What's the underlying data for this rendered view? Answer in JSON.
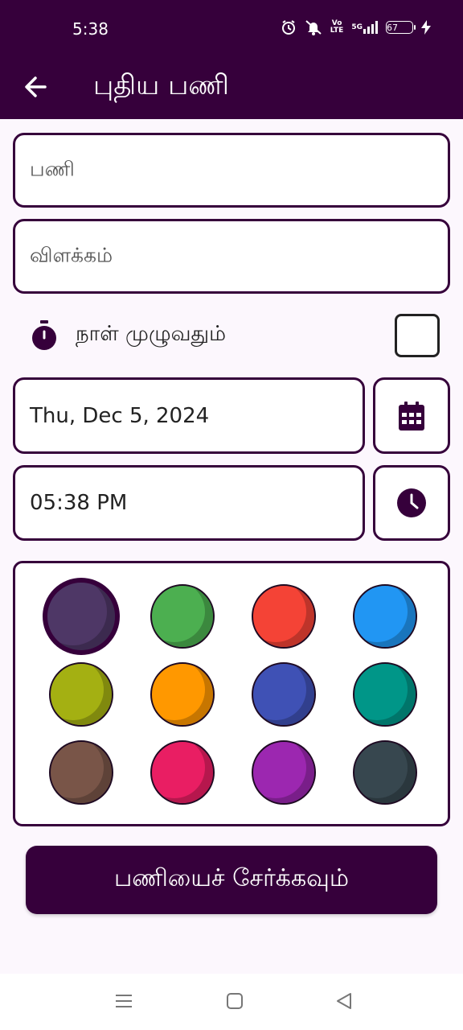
{
  "status_bar": {
    "time": "5:38",
    "network_label": "5G",
    "volte_label": "Vo\nLTE",
    "battery_level": "67"
  },
  "app_bar": {
    "title": "புதிய பணி",
    "background": "#36003b"
  },
  "form": {
    "task_placeholder": "பணி",
    "description_placeholder": "விளக்கம்",
    "all_day_label": "நாள் முழுவதும்",
    "all_day_checked": false,
    "date_value": "Thu, Dec 5, 2024",
    "time_value": "05:38 PM"
  },
  "colors": {
    "selected_index": 0,
    "swatches": [
      "#4e3766",
      "#4caf50",
      "#f44336",
      "#2196f3",
      "#a4b012",
      "#ff9800",
      "#3f51b5",
      "#009688",
      "#795548",
      "#e91e63",
      "#9c27b0",
      "#37474f"
    ]
  },
  "submit_label": "பணியைச் சேர்க்கவும்",
  "icons": {
    "back": "arrow-left-icon",
    "timer": "timer-icon",
    "calendar": "calendar-icon",
    "clock": "clock-icon"
  }
}
